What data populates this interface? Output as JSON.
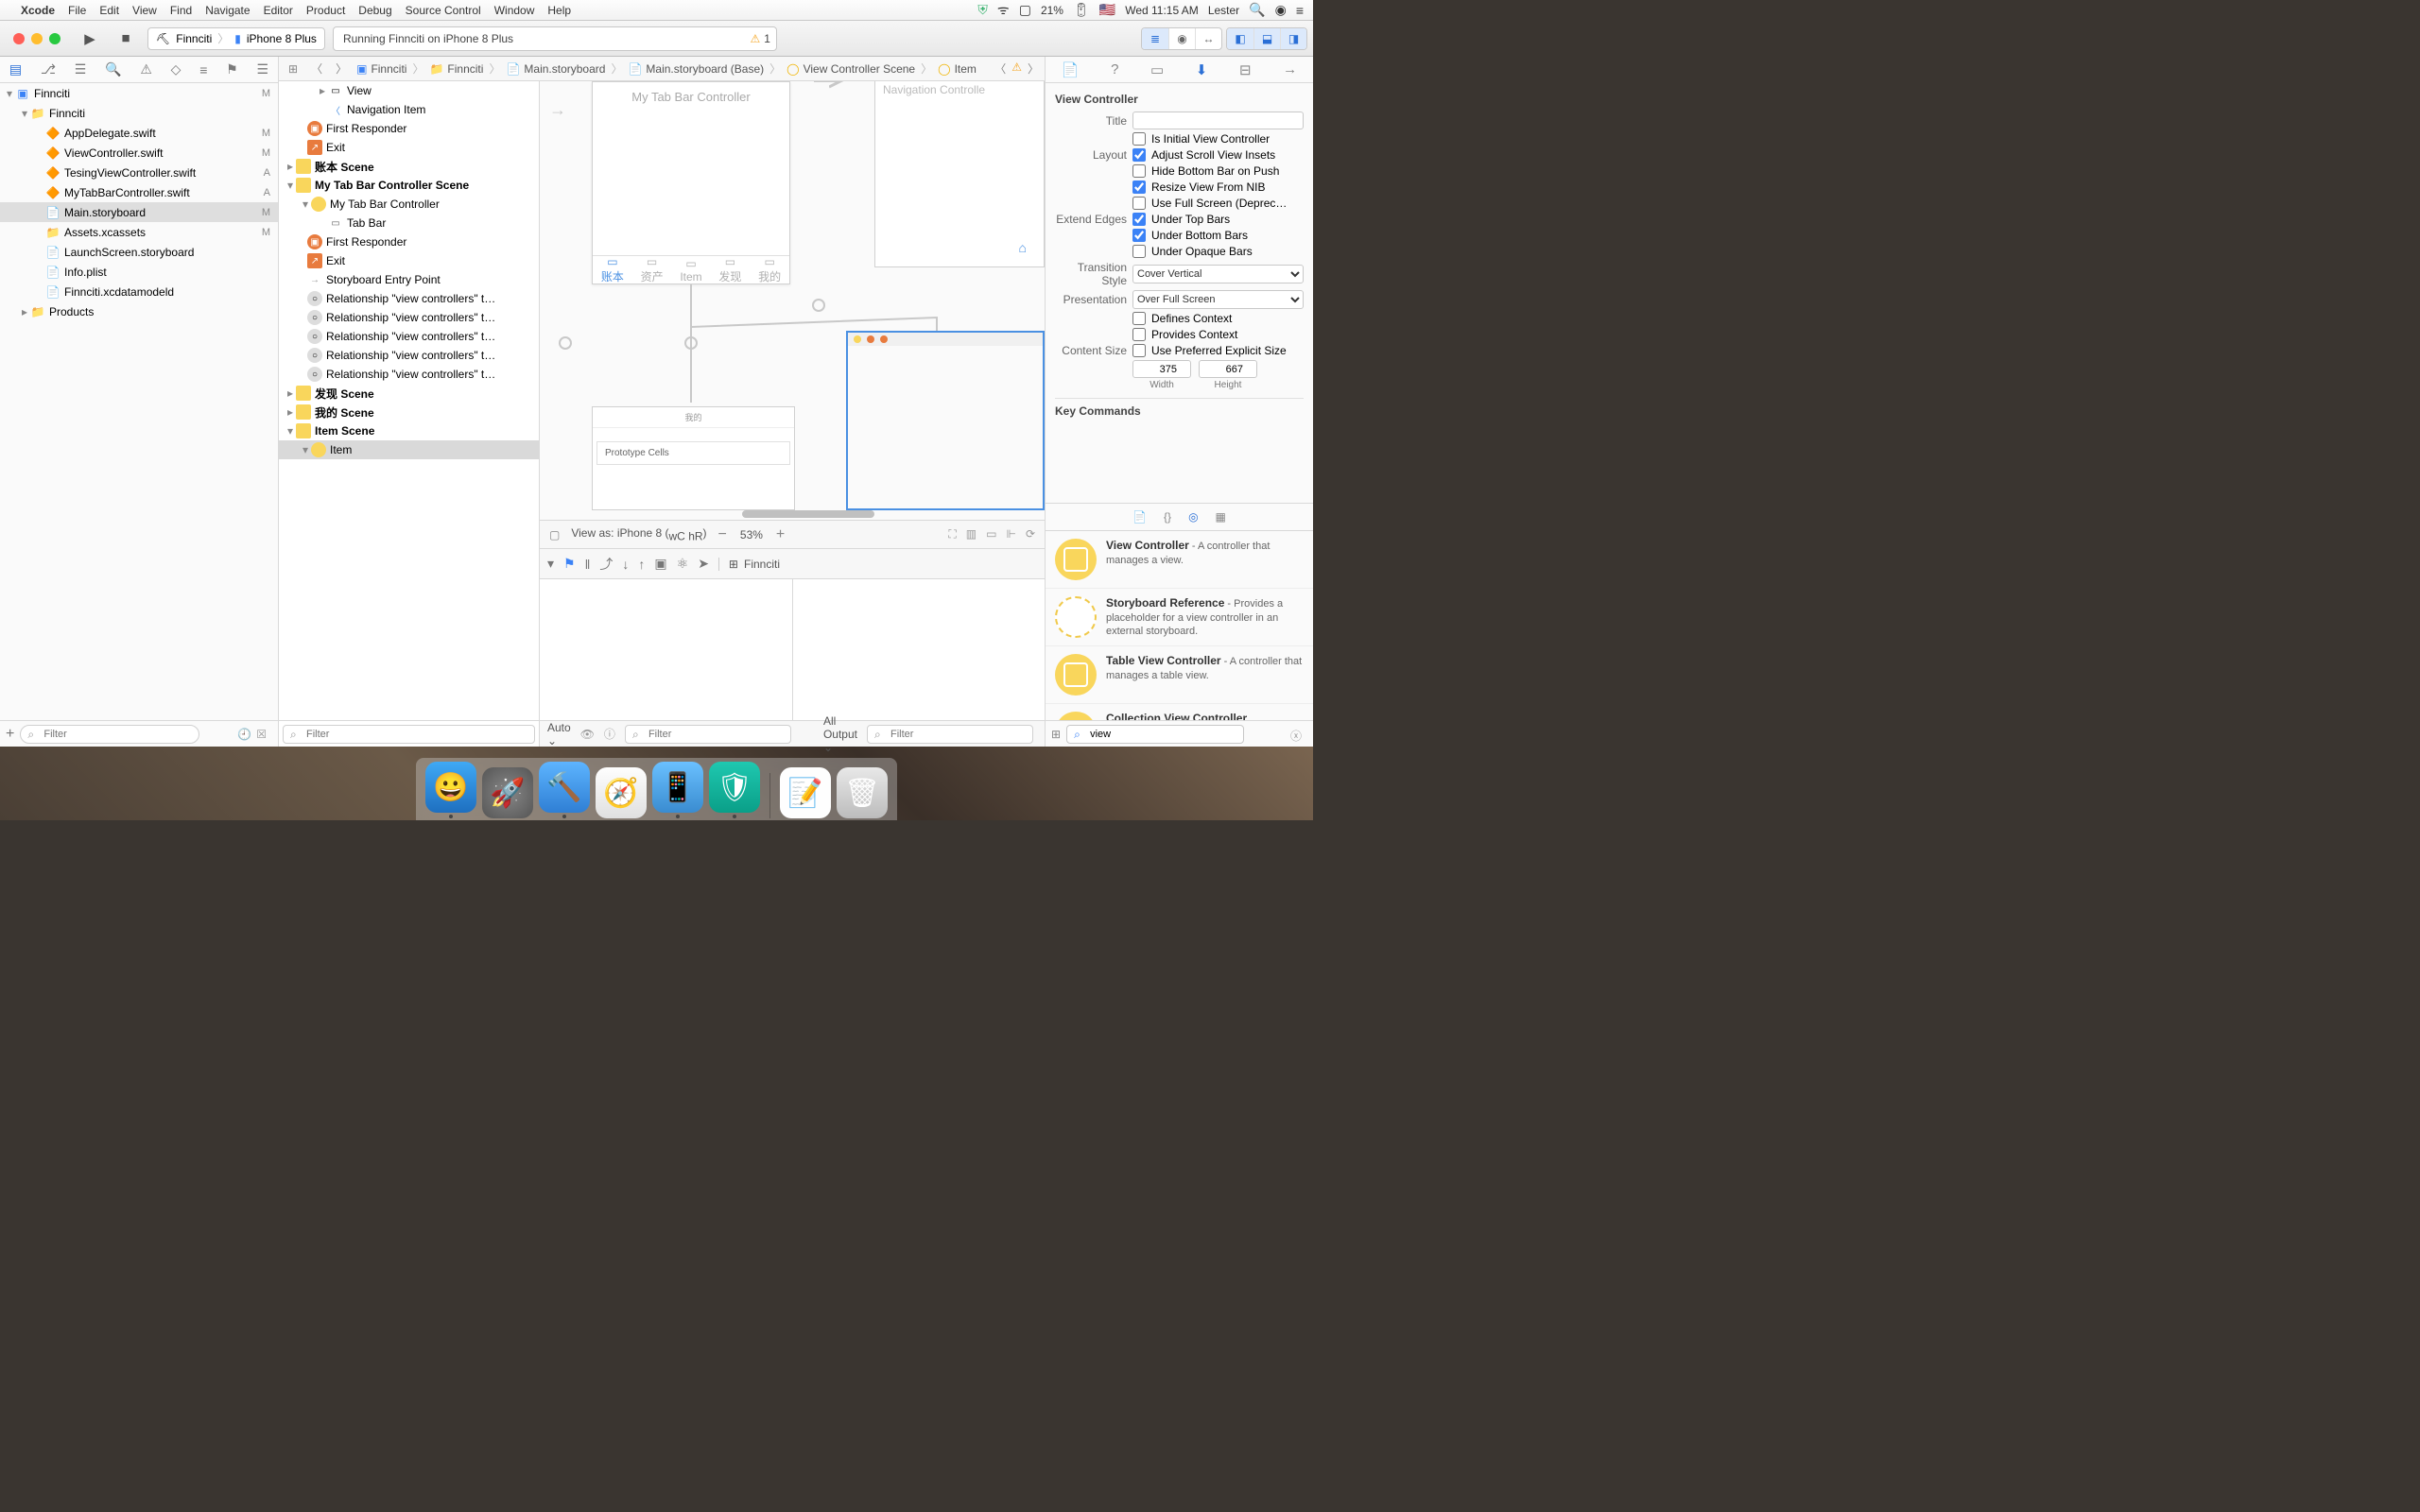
{
  "menubar": {
    "app": "Xcode",
    "items": [
      "File",
      "Edit",
      "View",
      "Find",
      "Navigate",
      "Editor",
      "Product",
      "Debug",
      "Source Control",
      "Window",
      "Help"
    ],
    "battery": "21%",
    "clock": "Wed 11:15 AM",
    "user": "Lester"
  },
  "toolbar": {
    "scheme_app": "Finnciti",
    "scheme_dest": "iPhone 8 Plus",
    "status": "Running Finnciti on iPhone 8 Plus",
    "warn_count": "1"
  },
  "jumpbar": {
    "crumbs": [
      "Finnciti",
      "Finnciti",
      "Main.storyboard",
      "Main.storyboard (Base)",
      "View Controller Scene",
      "Item"
    ]
  },
  "navigator": {
    "root": "Finnciti",
    "root_badge": "M",
    "group": "Finnciti",
    "files": [
      {
        "name": "AppDelegate.swift",
        "badge": "M",
        "icon": "swift"
      },
      {
        "name": "ViewController.swift",
        "badge": "M",
        "icon": "swift"
      },
      {
        "name": "TesingViewController.swift",
        "badge": "A",
        "icon": "swift"
      },
      {
        "name": "MyTabBarController.swift",
        "badge": "A",
        "icon": "swift"
      },
      {
        "name": "Main.storyboard",
        "badge": "M",
        "icon": "sb",
        "sel": true
      },
      {
        "name": "Assets.xcassets",
        "badge": "M",
        "icon": "assets"
      },
      {
        "name": "LaunchScreen.storyboard",
        "badge": "",
        "icon": "sb"
      },
      {
        "name": "Info.plist",
        "badge": "",
        "icon": "plist"
      },
      {
        "name": "Finnciti.xcdatamodeld",
        "badge": "",
        "icon": "data"
      }
    ],
    "products": "Products",
    "filter_ph": "Filter"
  },
  "outline": {
    "view": "View",
    "nav_item": "Navigation Item",
    "first_responder": "First Responder",
    "exit": "Exit",
    "scene_zhb": "账本 Scene",
    "scene_tabbar": "My Tab Bar Controller Scene",
    "tabbar_ctrl": "My Tab Bar Controller",
    "tab_bar": "Tab Bar",
    "sb_entry": "Storyboard Entry Point",
    "rel": "Relationship \"view controllers\" t…",
    "scene_fx": "发现 Scene",
    "scene_wd": "我的 Scene",
    "scene_item": "Item Scene",
    "item": "Item",
    "filter_ph": "Filter"
  },
  "canvas": {
    "tabbar_title": "My Tab Bar Controller",
    "nav_title": "Navigation Controlle",
    "proto_header": "我的",
    "proto_cells": "Prototype Cells",
    "tabs": [
      "账本",
      "资产",
      "Item",
      "发现",
      "我的"
    ],
    "view_as": "View as: iPhone 8 (",
    "view_as_wc": "wC",
    "view_as_hr": "hR",
    "view_as_end": ")",
    "zoom": "53%"
  },
  "debug": {
    "target": "Finnciti",
    "auto": "Auto",
    "all_output": "All Output",
    "filter_ph": "Filter"
  },
  "inspector": {
    "heading": "View Controller",
    "title_lbl": "Title",
    "initial": "Is Initial View Controller",
    "layout_lbl": "Layout",
    "adjust": "Adjust Scroll View Insets",
    "hide_bottom": "Hide Bottom Bar on Push",
    "resize_nib": "Resize View From NIB",
    "fullscreen": "Use Full Screen (Deprec…",
    "edges_lbl": "Extend Edges",
    "under_top": "Under Top Bars",
    "under_bottom": "Under Bottom Bars",
    "under_opaque": "Under Opaque Bars",
    "trans_lbl": "Transition Style",
    "trans_val": "Cover Vertical",
    "pres_lbl": "Presentation",
    "pres_val": "Over Full Screen",
    "defines": "Defines Context",
    "provides": "Provides Context",
    "csize_lbl": "Content Size",
    "csize_chk": "Use Preferred Explicit Size",
    "width": "375",
    "height": "667",
    "width_lbl": "Width",
    "height_lbl": "Height",
    "key_cmd": "Key Commands"
  },
  "library": {
    "items": [
      {
        "title": "View Controller",
        "desc": " - A controller that manages a view."
      },
      {
        "title": "Storyboard Reference",
        "desc": " - Provides a placeholder for a view controller in an external storyboard."
      },
      {
        "title": "Table View Controller",
        "desc": " - A controller that manages a table view."
      },
      {
        "title": "Collection View Controller",
        "desc": ""
      }
    ],
    "search": "view"
  }
}
